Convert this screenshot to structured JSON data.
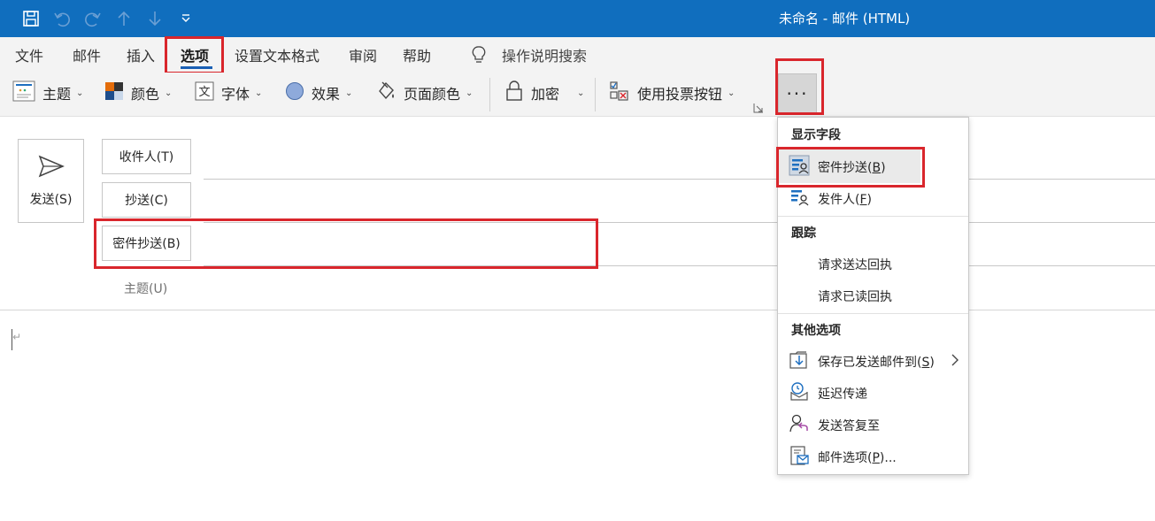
{
  "window": {
    "title": "未命名 - 邮件 (HTML)"
  },
  "quick_access": {
    "icons": [
      "save-icon",
      "undo-icon",
      "redo-icon",
      "up-icon",
      "down-icon",
      "customize-qat-icon"
    ]
  },
  "menu": {
    "tabs": [
      "文件",
      "邮件",
      "插入",
      "选项",
      "设置文本格式",
      "审阅",
      "帮助"
    ],
    "active_tab": "选项",
    "search_label": "操作说明搜索"
  },
  "ribbon": {
    "theme": "主题",
    "colors": "颜色",
    "fonts": "字体",
    "effects": "效果",
    "page_color": "页面颜色",
    "encrypt": "加密",
    "voting": "使用投票按钮",
    "more": "···"
  },
  "compose": {
    "send": "发送(S)",
    "to": "收件人(T)",
    "cc": "抄送(C)",
    "bcc": "密件抄送(B)",
    "subject": "主题(U)",
    "paragraph_mark": "↵"
  },
  "dropdown": {
    "show_fields_header": "显示字段",
    "bcc": {
      "text": "密件抄送(",
      "key": "B",
      "end": ")"
    },
    "from": {
      "text": "发件人(",
      "key": "F",
      "end": ")"
    },
    "tracking_header": "跟踪",
    "delivery_receipt": "请求送达回执",
    "read_receipt": "请求已读回执",
    "more_options_header": "其他选项",
    "save_sent": {
      "text": "保存已发送邮件到(",
      "key": "S",
      "end": ")"
    },
    "delay_delivery": "延迟传递",
    "direct_replies": "发送答复至",
    "message_options": {
      "text": "邮件选项(",
      "key": "P",
      "end": ")..."
    }
  },
  "colors": {
    "titlebar": "#106ebe",
    "highlight_red": "#d9262c",
    "ribbon_bg": "#f3f3f3"
  }
}
